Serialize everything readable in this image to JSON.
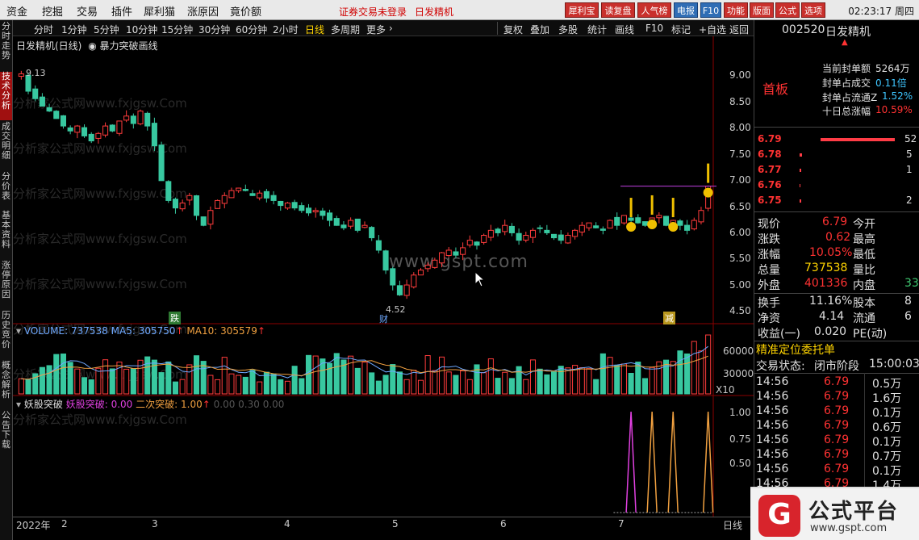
{
  "menu": [
    "资金",
    "挖掘",
    "交易",
    "插件",
    "犀利猫",
    "涨原因",
    "竟价额"
  ],
  "notice": "证券交易未登录",
  "notice_stock": "日发精机",
  "topbar_buttons": [
    {
      "label": "犀利宝",
      "color": "red"
    },
    {
      "label": "读复盘",
      "color": "red"
    },
    {
      "label": "人气榜",
      "color": "red"
    },
    {
      "label": "电报",
      "color": "blue"
    },
    {
      "label": "F10",
      "color": "blue"
    },
    {
      "label": "功能",
      "color": "red"
    },
    {
      "label": "版面",
      "color": "red"
    },
    {
      "label": "公式",
      "color": "red"
    },
    {
      "label": "选项",
      "color": "red"
    }
  ],
  "clock": "02:23:17 周四",
  "side_tabs": [
    "分时走势",
    "技术分析",
    "成交明细",
    "分价表",
    "基本资料",
    "涨停原因",
    "历史竞价",
    "概念解析",
    "公告下载"
  ],
  "side_active": "技术分析",
  "periods": [
    "分时",
    "1分钟",
    "5分钟",
    "10分钟",
    "15分钟",
    "30分钟",
    "60分钟",
    "2小时",
    "日线",
    "多周期",
    "更多"
  ],
  "period_selected": "日线",
  "right_tools": [
    "复权",
    "叠加",
    "多股",
    "统计",
    "画线",
    "F10",
    "标记",
    "+自选",
    "返回"
  ],
  "chart_header": {
    "stock": "日发精机(日线)",
    "formula": "暴力突破画线"
  },
  "watermark": "分析家公式网www.fxjgsw.Com",
  "gspt_watermark": "www.gspt.com",
  "chart_data": {
    "type": "candlestick",
    "price_ticks": [
      "9.00",
      "8.50",
      "8.00",
      "7.50",
      "7.00",
      "6.50",
      "6.00",
      "5.50",
      "5.00",
      "4.50"
    ],
    "ylim": [
      4.2,
      9.35
    ],
    "high_label": "9.13",
    "low_label": "4.52",
    "tags": [
      {
        "text": "跌",
        "color": "green"
      },
      {
        "text": "财",
        "color": "blue"
      },
      {
        "text": "减",
        "color": "gold"
      }
    ],
    "volume_header": {
      "name": "VOLUME",
      "value": "737538",
      "ma5_label": "MA5",
      "ma5": "305750",
      "ma10_label": "MA10",
      "ma10": "305579"
    },
    "volume_ticks": [
      "60000",
      "30000"
    ],
    "volume_unit": "X10",
    "indicator_header": {
      "name": "妖股突破",
      "l1_label": "妖股突破",
      "l1": "0.00",
      "l2_label": "二次突破",
      "l2": "1.00",
      "extra": "0.00 0.30 0.00"
    },
    "indicator_ticks": [
      "1.00",
      "0.75",
      "0.50"
    ],
    "x_labels": [
      "2022年",
      "2",
      "3",
      "4",
      "5",
      "6",
      "7"
    ],
    "x_right": "日线",
    "close_path": [
      9.05,
      8.7,
      8.55,
      8.4,
      8.3,
      8.15,
      8.0,
      7.9,
      8.0,
      7.8,
      7.7,
      7.85,
      8.0,
      7.9,
      8.1,
      8.2,
      8.05,
      8.3,
      8.0,
      7.6,
      6.9,
      6.5,
      6.35,
      6.45,
      6.6,
      6.2,
      6.0,
      6.3,
      6.5,
      6.6,
      6.7,
      6.75,
      6.7,
      6.6,
      6.65,
      6.55,
      6.5,
      6.4,
      6.45,
      6.35,
      6.3,
      6.25,
      6.3,
      6.2,
      6.1,
      6.0,
      5.95,
      6.1,
      5.9,
      6.0,
      5.75,
      5.5,
      5.1,
      4.8,
      4.6,
      4.8,
      5.0,
      5.1,
      5.2,
      5.3,
      5.45,
      5.5,
      5.4,
      5.55,
      5.7,
      5.6,
      5.8,
      5.9,
      5.85,
      6.0,
      5.85,
      5.7,
      5.8,
      5.9,
      5.95,
      5.85,
      5.75,
      5.7,
      5.8,
      5.9,
      6.0,
      6.05,
      5.95,
      5.9,
      6.1,
      6.0,
      6.2,
      6.1,
      6.05,
      6.0,
      6.15,
      6.2,
      6.0,
      6.1,
      6.0,
      5.9,
      6.1,
      6.3,
      6.79
    ]
  },
  "right_panel": {
    "code": "002520",
    "name": "日发精机",
    "tag": "首板",
    "stats": [
      {
        "label": "当前封单额",
        "value": "5264万"
      },
      {
        "label": "封单占成交",
        "value": "0.11倍"
      },
      {
        "label": "封单占流通Z",
        "value": "1.52%"
      },
      {
        "label": "十日总涨幅",
        "value": "10.59%"
      }
    ],
    "orderbook": [
      {
        "price": "6.79",
        "vol": "52"
      },
      {
        "price": "6.78",
        "vol": "5"
      },
      {
        "price": "6.77",
        "vol": "1"
      },
      {
        "price": "6.76",
        "vol": ""
      },
      {
        "price": "6.75",
        "vol": "2"
      }
    ],
    "quote": [
      {
        "label": "现价",
        "value": "6.79",
        "label2": "今开",
        "value2": ""
      },
      {
        "label": "涨跌",
        "value": "0.62",
        "label2": "最高",
        "value2": ""
      },
      {
        "label": "涨幅",
        "value": "10.05%",
        "label2": "最低",
        "value2": ""
      },
      {
        "label": "总量",
        "value": "737538",
        "label2": "量比",
        "value2": ""
      },
      {
        "label": "外盘",
        "value": "401336",
        "label2": "内盘",
        "value2": "33"
      }
    ],
    "quote2": [
      {
        "label": "换手",
        "value": "11.16%",
        "label2": "股本",
        "value2": "8"
      },
      {
        "label": "净资",
        "value": "4.14",
        "label2": "流通",
        "value2": "6"
      },
      {
        "label": "收益(一)",
        "value": "0.020",
        "label2": "PE(动)",
        "value2": ""
      }
    ],
    "precise": "精准定位委托单",
    "trade_state_label": "交易状态:",
    "trade_state": "闭市阶段",
    "trade_time": "15:00:03",
    "ticks": [
      {
        "time": "14:56",
        "price": "6.79",
        "vol": "0.5万"
      },
      {
        "time": "14:56",
        "price": "6.79",
        "vol": "1.6万"
      },
      {
        "time": "14:56",
        "price": "6.79",
        "vol": "0.1万"
      },
      {
        "time": "14:56",
        "price": "6.79",
        "vol": "0.6万"
      },
      {
        "time": "14:56",
        "price": "6.79",
        "vol": "0.1万"
      },
      {
        "time": "14:56",
        "price": "6.79",
        "vol": "0.7万"
      },
      {
        "time": "14:56",
        "price": "6.79",
        "vol": "0.1万"
      },
      {
        "time": "14:56",
        "price": "6.79",
        "vol": "1.4万"
      }
    ]
  },
  "brand": {
    "logo": "G",
    "name": "公式平台",
    "url": "www.gspt.com"
  }
}
